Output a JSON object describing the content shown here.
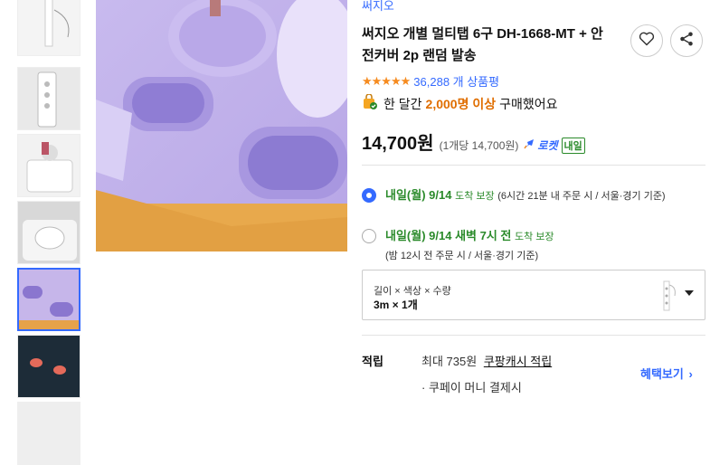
{
  "product": {
    "brand": "써지오",
    "title": "써지오 개별 멀티탭 6구 DH-1668-MT + 안전커버 2p 랜덤 발송",
    "stars": "★★★★★",
    "review_count": "36,288 개 상품평",
    "bought_prefix": "한 달간",
    "bought_highlight": "2,000명 이상",
    "bought_suffix": "구매했어요",
    "price": "14,700원",
    "unit_price": "(1개당 14,700원)",
    "rocket_label": "로켓",
    "rocket_badge": "내일"
  },
  "delivery": {
    "options": [
      {
        "selected": true,
        "headline": "내일(월) 9/14",
        "kind": "도착 보장",
        "detail": "(6시간 21분 내 주문 시 / 서울·경기 기준)"
      },
      {
        "selected": false,
        "headline": "내일(월) 9/14 새벽 7시 전",
        "kind": "도착 보장",
        "detail": "(밤 12시 전 주문 시 / 서울·경기 기준)"
      }
    ]
  },
  "option_selector": {
    "label": "길이 × 색상 × 수량",
    "value": "3m × 1개"
  },
  "reward": {
    "label": "적립",
    "max_text": "최대 735원",
    "link_text": "쿠팡캐시 적립",
    "benefit_link": "혜택보기",
    "coupay_text": "· 쿠페이 머니 결제시"
  },
  "icons": {
    "wishlist": "heart-icon",
    "share": "share-icon",
    "rocket": "rocket-icon",
    "bag": "shopping-bag-check-icon"
  },
  "colors": {
    "accent": "#346aff",
    "green": "#2a8a2a",
    "orange": "#e06e00",
    "star": "#f68b1f"
  }
}
